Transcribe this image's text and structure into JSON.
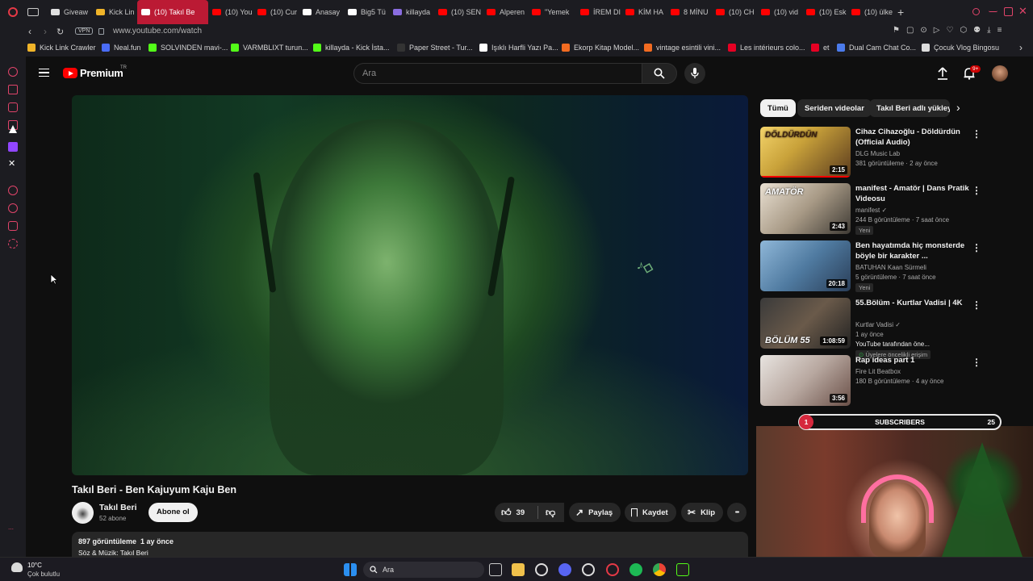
{
  "browser": {
    "tabs": [
      {
        "label": "Giveaw",
        "fav": "#e0e0e0"
      },
      {
        "label": "Kick Lin",
        "fav": "#f0b429"
      },
      {
        "label": "(10) Takıl Be",
        "fav": "#ff0000",
        "active": true
      },
      {
        "label": "(10) You",
        "fav": "#ff0000"
      },
      {
        "label": "(10) Cur",
        "fav": "#ff0000"
      },
      {
        "label": "Anasay",
        "fav": "#ffffff"
      },
      {
        "label": "Big5 Tü",
        "fav": "#ffffff"
      },
      {
        "label": "killayda",
        "fav": "#8a6de0"
      },
      {
        "label": "(10) SEN",
        "fav": "#ff0000"
      },
      {
        "label": "Alperen",
        "fav": "#ff0000"
      },
      {
        "label": "\"Yemek",
        "fav": "#ff0000"
      },
      {
        "label": "İREM DI",
        "fav": "#ff0000"
      },
      {
        "label": "KİM HA",
        "fav": "#ff0000"
      },
      {
        "label": "8 MİNU",
        "fav": "#ff0000"
      },
      {
        "label": "(10) CH",
        "fav": "#ff0000"
      },
      {
        "label": "(10) vid",
        "fav": "#ff0000"
      },
      {
        "label": "(10) Esk",
        "fav": "#ff0000"
      },
      {
        "label": "(10) ülke",
        "fav": "#ff0000"
      }
    ],
    "new_tab": "+",
    "vpn_badge": "VPN",
    "url": "www.youtube.com/watch",
    "bookmarks": [
      {
        "label": "Kick Link Crawler",
        "fav": "#f0b429"
      },
      {
        "label": "Neal.fun",
        "fav": "#4a6cf7"
      },
      {
        "label": "SOLVINDEN mavi-...",
        "fav": "#53fc18"
      },
      {
        "label": "VARMBLIXT turun...",
        "fav": "#53fc18"
      },
      {
        "label": "killayda - Kick İsta...",
        "fav": "#53fc18"
      },
      {
        "label": "Paper Street - Tur...",
        "fav": "#333333"
      },
      {
        "label": "Işıklı Harfli Yazı Pa...",
        "fav": "#ffffff"
      },
      {
        "label": "Ekorp Kitap Model...",
        "fav": "#f26b21"
      },
      {
        "label": "vintage esintili vini...",
        "fav": "#f26b21"
      },
      {
        "label": "Les intérieurs colo...",
        "fav": "#e60023"
      },
      {
        "label": "et",
        "fav": "#e60023"
      },
      {
        "label": "Dual Cam Chat Co...",
        "fav": "#4b7bec"
      },
      {
        "label": "Çocuk Vlog Bingosu",
        "fav": "#dddddd"
      }
    ]
  },
  "youtube": {
    "logo_text": "Premium",
    "logo_region": "TR",
    "search_placeholder": "Ara",
    "notification_count": "9+",
    "video": {
      "title": "Takıl Beri - Ben Kajuyum Kaju Ben",
      "channel": "Takıl Beri",
      "subscribers": "52 abone",
      "subscribe_label": "Abone ol",
      "likes": "39",
      "share_label": "Paylaş",
      "save_label": "Kaydet",
      "clip_label": "Klip",
      "more_label": "•••",
      "views_date": "897 görüntüleme  1 ay önce",
      "description": "Söz & Müzik: Takıl Beri"
    },
    "chips": [
      "Tümü",
      "Seriden videolar",
      "Takıl Beri adlı yükleyi"
    ],
    "recommendations": [
      {
        "title": "Cihaz Cihazoğlu - Döldürdün (Official Audio)",
        "channel": "DLG Music Lab",
        "meta": "381 görüntüleme · 2 ay önce",
        "duration": "2:15",
        "thumb_text": "DÖLDÜRDÜN"
      },
      {
        "title": "manifest - Amatör | Dans Pratik Videosu",
        "channel": "manifest ✓",
        "meta": "244 B görüntüleme · 7 saat önce",
        "badge": "Yeni",
        "duration": "2:43",
        "thumb_text": "AMATÖR"
      },
      {
        "title": "Ben hayatımda hiç monsterde böyle bir karakter ...",
        "channel": "BATUHAN Kaan Sürmeli",
        "meta": "5 görüntüleme · 7 saat önce",
        "badge": "Yeni",
        "duration": "20:18",
        "thumb_text": ""
      },
      {
        "title": "55.Bölüm - Kurtlar Vadisi | 4K",
        "channel": "Kurtlar Vadisi ✓",
        "meta": "1 ay önce",
        "extra": "YouTube tarafından öne...",
        "members": "Üyelere öncelikli erişim",
        "duration": "1:08:59",
        "thumb_text": "BÖLÜM 55"
      },
      {
        "title": "Rap ideas part 1",
        "channel": "Fire Lit Beatbox",
        "meta": "180 B görüntüleme · 4 ay önce",
        "duration": "3:56",
        "thumb_text": ""
      }
    ]
  },
  "overlay": {
    "subs_left": "1",
    "subs_label": "SUBSCRIBERS",
    "subs_right": "25"
  },
  "taskbar": {
    "weather_temp": "10°C",
    "weather_desc": "Çok bulutlu",
    "search_label": "Ara"
  }
}
